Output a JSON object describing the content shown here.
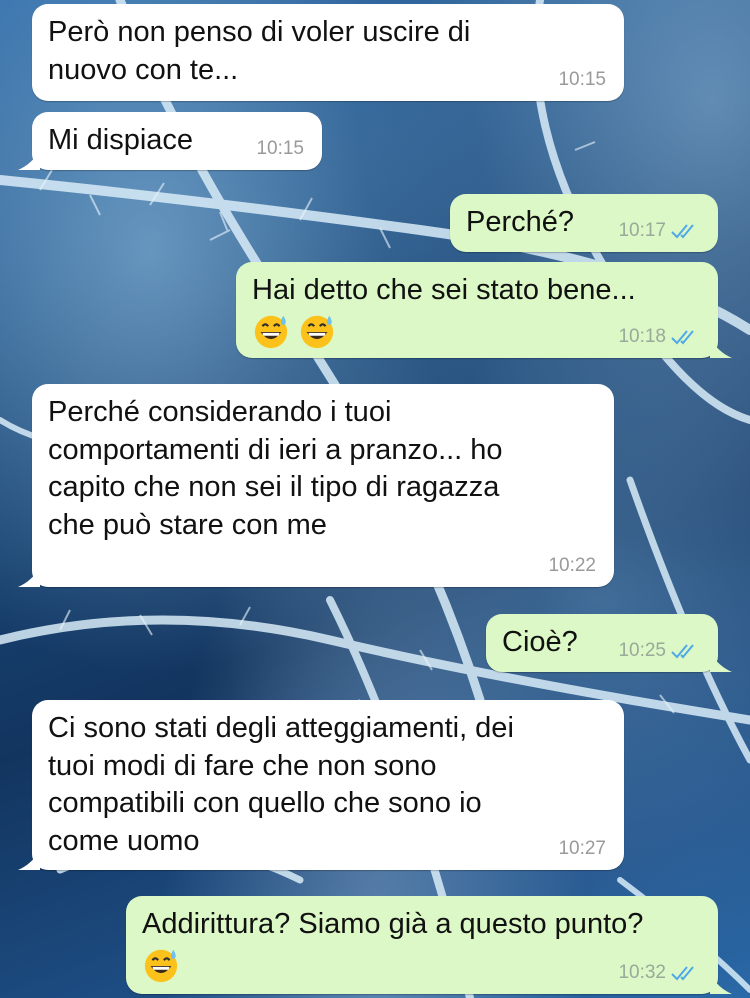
{
  "messages": [
    {
      "id": "m1",
      "direction": "in",
      "text": "Però non penso di voler uscire di\nnuovo con te...",
      "time": "10:15",
      "emoji_count": 0
    },
    {
      "id": "m2",
      "direction": "in",
      "text": "Mi dispiace",
      "time": "10:15",
      "emoji_count": 0
    },
    {
      "id": "m3",
      "direction": "out",
      "text": "Perché?",
      "time": "10:17",
      "emoji_count": 0,
      "status": "read"
    },
    {
      "id": "m4",
      "direction": "out",
      "text": "Hai detto che sei stato bene...",
      "time": "10:18",
      "emoji_count": 2,
      "emoji": "grinning-face-with-sweat",
      "status": "read"
    },
    {
      "id": "m5",
      "direction": "in",
      "text": "Perché considerando i tuoi\ncomportamenti di ieri a pranzo... ho\ncapito che non sei il tipo di ragazza\nche può stare con me",
      "time": "10:22",
      "emoji_count": 0
    },
    {
      "id": "m6",
      "direction": "out",
      "text": "Cioè?",
      "time": "10:25",
      "emoji_count": 0,
      "status": "read"
    },
    {
      "id": "m7",
      "direction": "in",
      "text": "Ci sono stati degli atteggiamenti, dei\ntuoi modi di fare che non sono\ncompatibili con quello che sono io\ncome uomo",
      "time": "10:27",
      "emoji_count": 0
    },
    {
      "id": "m8",
      "direction": "out",
      "text": "Addirittura? Siamo già a questo punto?",
      "time": "10:32",
      "emoji_count": 1,
      "emoji": "grinning-face-with-sweat",
      "status": "read"
    }
  ],
  "colors": {
    "incoming_bubble": "#ffffff",
    "outgoing_bubble": "#dcf8c6",
    "read_ticks": "#4fa9e8",
    "timestamp": "#9a9a9a"
  },
  "icons": {
    "read_receipt": "double-check-icon",
    "emoji": "grinning-face-with-sweat"
  }
}
